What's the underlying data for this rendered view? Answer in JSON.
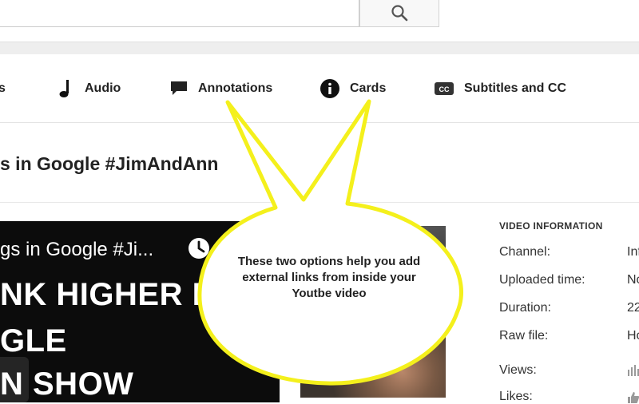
{
  "search": {
    "placeholder": "",
    "value": ""
  },
  "tabs": [
    {
      "label": "s",
      "icon": "truncated-tab"
    },
    {
      "label": "Audio",
      "icon": "music-note-icon"
    },
    {
      "label": "Annotations",
      "icon": "speech-bubble-icon"
    },
    {
      "label": "Cards",
      "icon": "info-icon"
    },
    {
      "label": "Subtitles and CC",
      "icon": "cc-icon"
    }
  ],
  "video": {
    "title": "s in Google #JimAndAnn"
  },
  "player": {
    "title": "gs in Google #Ji...",
    "thumb_lines": [
      "NK HIGHER IN",
      "GLE",
      "N SHOW"
    ]
  },
  "info": {
    "heading": "VIDEO INFORMATION",
    "rows": [
      {
        "key": "Channel:",
        "value": "Inf"
      },
      {
        "key": "Uploaded time:",
        "value": "No"
      },
      {
        "key": "Duration:",
        "value": "22"
      },
      {
        "key": "Raw file:",
        "value": "Ho"
      },
      {
        "key": "Views:",
        "value": ""
      },
      {
        "key": "Likes:",
        "value": ""
      }
    ]
  },
  "callout": {
    "text": "These two options help you add external links from inside your Youtbe video",
    "fill": "#ffffff",
    "stroke": "#f4f01c"
  }
}
